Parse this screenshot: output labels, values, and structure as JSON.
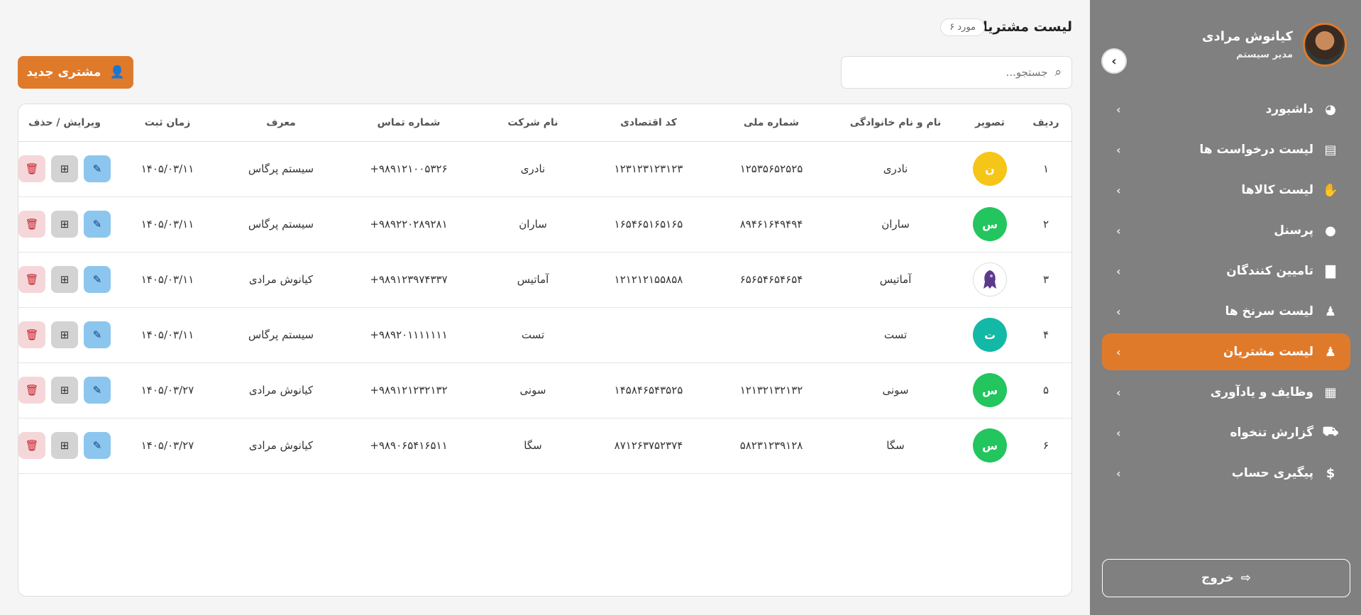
{
  "sidebar": {
    "user_name": "کیانوش مرادی",
    "user_role": "مدیر سیستم",
    "collapse_icon": "chevron-left-icon",
    "items": [
      {
        "label": "داشبورد",
        "icon": "dashboard-gauge-icon",
        "glyph": "◕",
        "active": false
      },
      {
        "label": "لیست درخواست ها",
        "icon": "document-chart-icon",
        "glyph": "▤",
        "active": false
      },
      {
        "label": "لیست کالاها",
        "icon": "hand-box-icon",
        "glyph": "✋",
        "active": false
      },
      {
        "label": "پرسنل",
        "icon": "user-icon",
        "glyph": "●",
        "active": false
      },
      {
        "label": "تامیین کنندگان",
        "icon": "industry-icon",
        "glyph": "▇",
        "active": false
      },
      {
        "label": "لیست سرنخ ها",
        "icon": "users-icon",
        "glyph": "♟",
        "active": false
      },
      {
        "label": "لیست مشتریان",
        "icon": "users-icon",
        "glyph": "♟",
        "active": true
      },
      {
        "label": "وظایف و یادآوری",
        "icon": "calendar-icon",
        "glyph": "▦",
        "active": false
      },
      {
        "label": "گزارش تنخواه",
        "icon": "cart-icon",
        "glyph": "⛟",
        "active": false
      },
      {
        "label": "پیگیری حساب",
        "icon": "money-bag-icon",
        "glyph": "$",
        "active": false
      }
    ],
    "logout_label": "خروج"
  },
  "header": {
    "title": "لیست مشتریان",
    "count_badge": "۶ مورد"
  },
  "search": {
    "placeholder": "جستجو..."
  },
  "new_customer_label": "مشتری جدید",
  "table": {
    "columns": [
      "ردیف",
      "تصویر",
      "نام و نام خانوادگی",
      "شماره ملی",
      "کد اقتصادی",
      "نام شرکت",
      "شماره تماس",
      "معرف",
      "زمان ثبت",
      "ویرایش / حذف"
    ],
    "rows": [
      {
        "index": "۱",
        "avatar_letter": "ن",
        "avatar_color": "#f5c518",
        "name": "نادری",
        "national_id": "۱۲۵۳۵۶۵۲۵۲۵",
        "economic_code": "۱۲۳۱۲۳۱۲۳۱۲۳",
        "company": "نادری",
        "phone": "+۹۸۹۱۲۱۰۰۵۳۲۶",
        "referrer": "سیستم پرگاس",
        "date": "۱۴۰۵/۰۳/۱۱"
      },
      {
        "index": "۲",
        "avatar_letter": "س",
        "avatar_color": "#22c55e",
        "name": "ساران",
        "national_id": "۸۹۴۶۱۶۴۹۴۹۴",
        "economic_code": "۱۶۵۴۶۵۱۶۵۱۶۵",
        "company": "ساران",
        "phone": "+۹۸۹۲۲۰۲۸۹۲۸۱",
        "referrer": "سیستم پرگاس",
        "date": "۱۴۰۵/۰۳/۱۱"
      },
      {
        "index": "۳",
        "avatar_letter": "",
        "avatar_color": "photo",
        "name": "آماتیس",
        "national_id": "۶۵۶۵۴۶۵۴۶۵۴",
        "economic_code": "۱۲۱۲۱۲۱۵۵۸۵۸",
        "company": "آماتیس",
        "phone": "+۹۸۹۱۲۳۹۷۴۳۳۷",
        "referrer": "کیانوش مرادی",
        "date": "۱۴۰۵/۰۳/۱۱"
      },
      {
        "index": "۴",
        "avatar_letter": "ت",
        "avatar_color": "#14b8a6",
        "name": "تست",
        "national_id": "",
        "economic_code": "",
        "company": "تست",
        "phone": "+۹۸۹۲۰۱۱۱۱۱۱۱",
        "referrer": "سیستم پرگاس",
        "date": "۱۴۰۵/۰۳/۱۱"
      },
      {
        "index": "۵",
        "avatar_letter": "س",
        "avatar_color": "#22c55e",
        "name": "سونی",
        "national_id": "۱۲۱۳۲۱۳۲۱۳۲",
        "economic_code": "۱۴۵۸۴۶۵۴۳۵۲۵",
        "company": "سونی",
        "phone": "+۹۸۹۱۲۱۲۳۲۱۳۲",
        "referrer": "کیانوش مرادی",
        "date": "۱۴۰۵/۰۳/۲۷"
      },
      {
        "index": "۶",
        "avatar_letter": "س",
        "avatar_color": "#22c55e",
        "name": "سگا",
        "national_id": "۵۸۲۳۱۲۳۹۱۲۸",
        "economic_code": "۸۷۱۲۶۳۷۵۲۳۷۴",
        "company": "سگا",
        "phone": "+۹۸۹۰۶۵۴۱۶۵۱۱",
        "referrer": "کیانوش مرادی",
        "date": "۱۴۰۵/۰۳/۲۷"
      }
    ]
  }
}
